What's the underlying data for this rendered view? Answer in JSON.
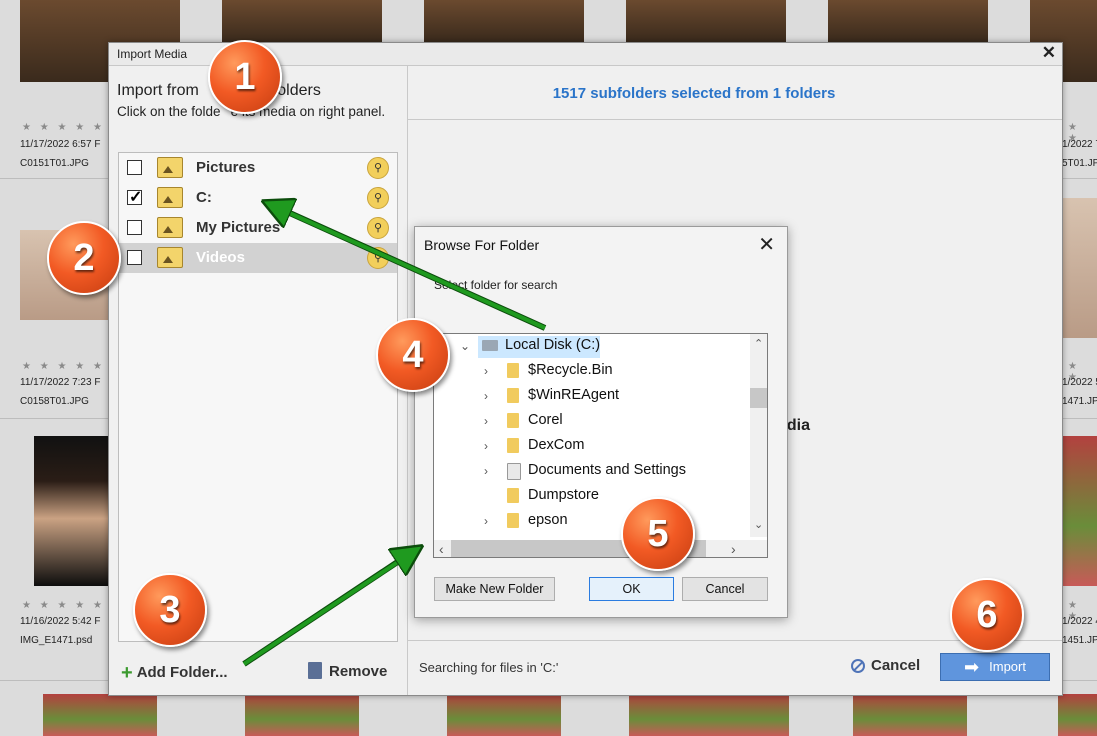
{
  "background": {
    "cells": [
      {
        "stars": "★ ★ ★ ★ ★",
        "date": "11/17/2022 6:57 F",
        "file": "C0151T01.JPG"
      },
      {
        "stars": "★ ★ ★ ★ ★",
        "date": "11/17/2022 7:23 F",
        "file": "C0158T01.JPG"
      },
      {
        "stars": "★ ★ ★ ★ ★",
        "date": "11/16/2022 5:42 F",
        "file": "IMG_E1471.psd"
      }
    ],
    "right_cells": [
      {
        "stars": "★ ★",
        "date": "1/2022 7",
        "file": "5T01.JPG"
      },
      {
        "stars": "★ ★",
        "date": "1/2022 5",
        "file": "1471.JPG"
      },
      {
        "stars": "★ ★",
        "date": "1/2022 4",
        "file": "1451.JPG"
      }
    ]
  },
  "dialog": {
    "title": "Import Media",
    "close": "✕",
    "left": {
      "heading_a": "Import from",
      "heading_b": "folders",
      "sub_a": "Click on the folde",
      "sub_b": "e its media on right panel.",
      "folders": [
        {
          "name": "Pictures",
          "checked": false,
          "selected": false
        },
        {
          "name": "C:",
          "checked": true,
          "selected": false
        },
        {
          "name": "My Pictures",
          "checked": false,
          "selected": false
        },
        {
          "name": "Videos",
          "checked": false,
          "selected": true
        }
      ],
      "binoc_glyph": "⚲",
      "add_folder": "Add Folder...",
      "plus": "+",
      "remove": "Remove"
    },
    "right": {
      "subfolder_count": "1517 subfolders selected from 1 folders",
      "media_fragment": "edia",
      "searching": "Searching for files in 'C:'",
      "cancel": "Cancel",
      "import": "Import",
      "import_arrow": "➡"
    }
  },
  "browse": {
    "title": "Browse For Folder",
    "close": "✕",
    "label": "Select folder for search",
    "items": [
      {
        "label": "Local Disk (C:)",
        "expand": "⌄",
        "level": 0
      },
      {
        "label": "$Recycle.Bin",
        "expand": "›",
        "level": 1
      },
      {
        "label": "$WinREAgent",
        "expand": "›",
        "level": 1
      },
      {
        "label": "Corel",
        "expand": "›",
        "level": 1
      },
      {
        "label": "DexCom",
        "expand": "›",
        "level": 1
      },
      {
        "label": "Documents and Settings",
        "expand": "›",
        "level": 1
      },
      {
        "label": "Dumpstore",
        "expand": "",
        "level": 1
      },
      {
        "label": "epson",
        "expand": "›",
        "level": 1
      }
    ],
    "scroll_up": "⌃",
    "scroll_down": "⌄",
    "scroll_left": "‹",
    "scroll_right": "›",
    "make_new_folder": "Make New Folder",
    "ok": "OK",
    "cancel": "Cancel"
  },
  "callouts": [
    "1",
    "2",
    "3",
    "4",
    "5",
    "6"
  ],
  "colors": {
    "accent": "#2a74c9",
    "callout": "#f25a24",
    "arrow": "#1f9a1f"
  }
}
